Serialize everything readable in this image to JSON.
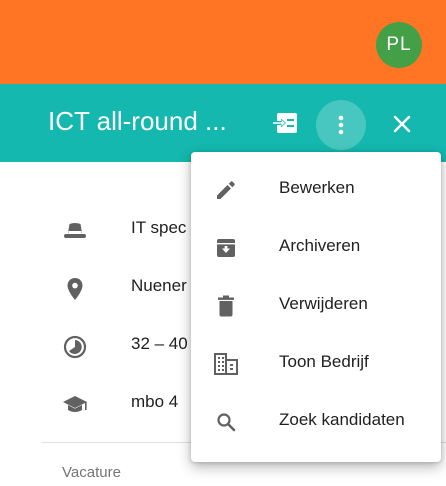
{
  "topbar": {
    "avatar_initials": "PL",
    "bg_color": "#ff7524",
    "avatar_color": "#43a047"
  },
  "header": {
    "title": "ICT all-round ...",
    "bg_color": "#14b8ae",
    "move_icon": "move-to-inbox-icon",
    "more_icon": "more-vert-icon",
    "close_icon": "close-icon"
  },
  "details": [
    {
      "icon": "hat-icon",
      "text": "IT spec"
    },
    {
      "icon": "location-pin-icon",
      "text": "Nuener"
    },
    {
      "icon": "clock-icon",
      "text": "32 – 40"
    },
    {
      "icon": "graduation-cap-icon",
      "text": "mbo 4"
    }
  ],
  "section_label": "Vacature",
  "menu": {
    "items": [
      {
        "icon": "pencil-icon",
        "label": "Bewerken"
      },
      {
        "icon": "archive-icon",
        "label": "Archiveren"
      },
      {
        "icon": "trash-icon",
        "label": "Verwijderen"
      },
      {
        "icon": "building-icon",
        "label": "Toon Bedrijf"
      },
      {
        "icon": "search-icon",
        "label": "Zoek kandidaten"
      }
    ]
  }
}
